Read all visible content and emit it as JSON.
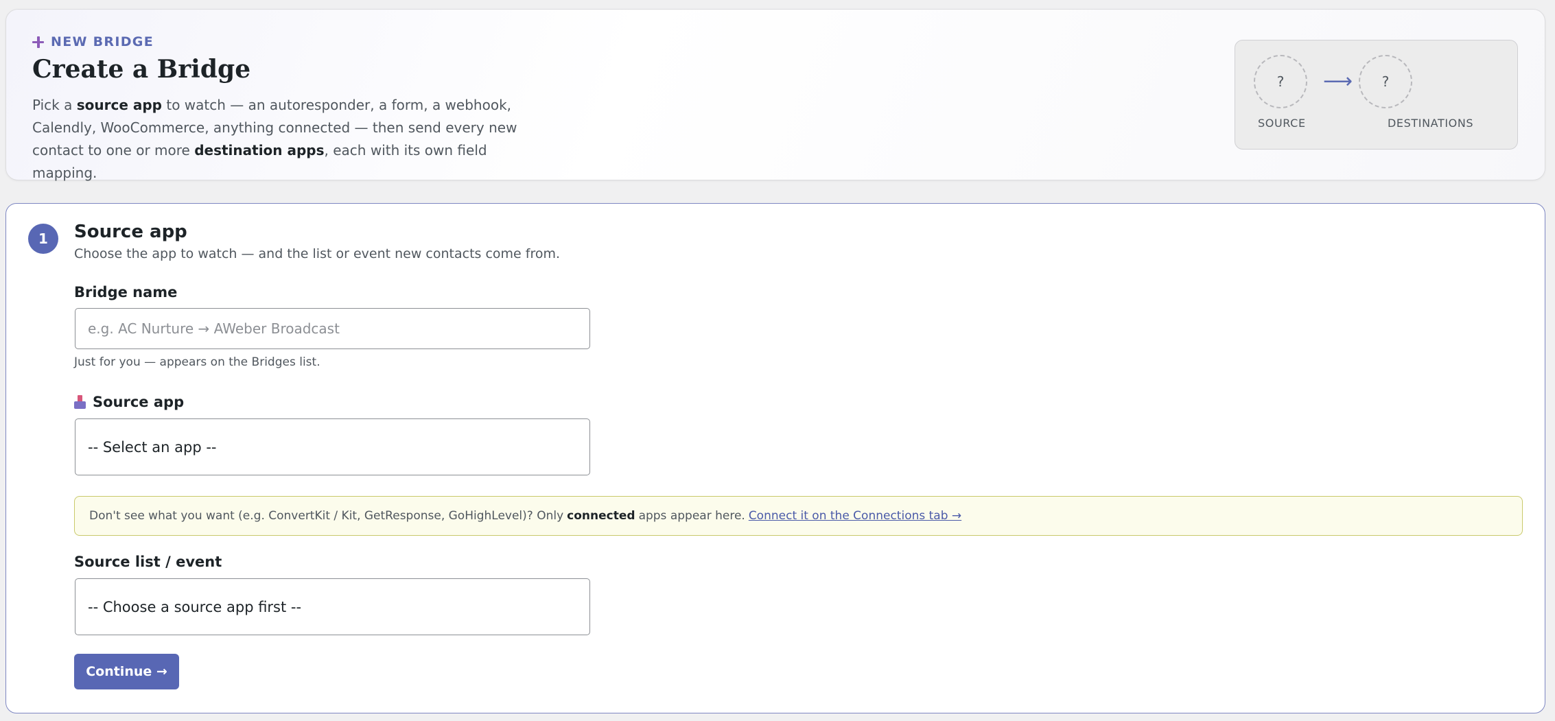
{
  "header": {
    "eyebrow": "NEW BRIDGE",
    "title": "Create a Bridge",
    "description": {
      "part1": "Pick a ",
      "source_app": "source app",
      "part2": " to watch — an autoresponder, a form, a webhook, Calendly, WooCommerce, anything connected — then send every new contact to one or more ",
      "destination_apps": "destination apps",
      "part3": ", each with its own field mapping."
    },
    "flow": {
      "source_symbol": "?",
      "arrow": "⟶",
      "dest_symbol": "?",
      "source_label": "SOURCE",
      "dest_label": "DESTINATIONS"
    }
  },
  "step": {
    "number": "1",
    "title": "Source app",
    "subtitle": "Choose the app to watch — and the list or event new contacts come from.",
    "bridge_name": {
      "label": "Bridge name",
      "placeholder": "e.g. AC Nurture → AWeber Broadcast",
      "value": "",
      "help": "Just for you — appears on the Bridges list."
    },
    "source_app": {
      "label": "Source app",
      "icon": "inbox-tray-icon",
      "selected": "-- Select an app --"
    },
    "notice": {
      "text1": "Don't see what you want (e.g. ConvertKit / Kit, GetResponse, GoHighLevel)? Only",
      "bold": "connected",
      "text2": "apps appear here.",
      "link": "Connect it on the Connections tab →"
    },
    "source_list": {
      "label": "Source list / event",
      "selected": "-- Choose a source app first --"
    },
    "continue_label": "Continue →"
  },
  "colors": {
    "accent": "#5867b4",
    "step_border": "#7d86c2",
    "notice_bg": "#fcfcec",
    "notice_border": "#c9c96a",
    "plus": "#8c5bb8"
  }
}
